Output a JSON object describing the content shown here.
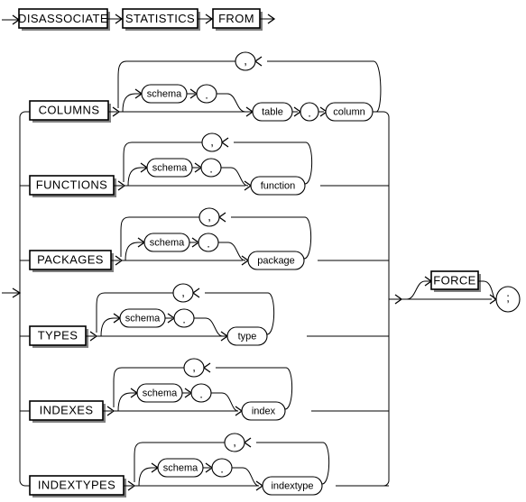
{
  "diagram": {
    "title": "disassociate_statistics_from",
    "type": "railroad-syntax-diagram",
    "colors": {
      "line": "#000000",
      "box_fill": "#ffffff",
      "box_shadow": "#808080",
      "background": "#ffffff"
    },
    "head": {
      "keywords": [
        {
          "id": "kw-disassociate",
          "label": "DISASSOCIATE"
        },
        {
          "id": "kw-statistics",
          "label": "STATISTICS"
        },
        {
          "id": "kw-from",
          "label": "FROM"
        }
      ]
    },
    "branches": [
      {
        "id": "columns",
        "keyword": "COLUMNS",
        "optional_schema": "schema",
        "dot": ".",
        "objects": [
          "table",
          "column"
        ],
        "object_separator": ".",
        "repeat_separator": ","
      },
      {
        "id": "functions",
        "keyword": "FUNCTIONS",
        "optional_schema": "schema",
        "dot": ".",
        "objects": [
          "function"
        ],
        "object_separator": "",
        "repeat_separator": ","
      },
      {
        "id": "packages",
        "keyword": "PACKAGES",
        "optional_schema": "schema",
        "dot": ".",
        "objects": [
          "package"
        ],
        "object_separator": "",
        "repeat_separator": ","
      },
      {
        "id": "types",
        "keyword": "TYPES",
        "optional_schema": "schema",
        "dot": ".",
        "objects": [
          "type"
        ],
        "object_separator": "",
        "repeat_separator": ","
      },
      {
        "id": "indexes",
        "keyword": "INDEXES",
        "optional_schema": "schema",
        "dot": ".",
        "objects": [
          "index"
        ],
        "object_separator": "",
        "repeat_separator": ","
      },
      {
        "id": "indextypes",
        "keyword": "INDEXTYPES",
        "optional_schema": "schema",
        "dot": ".",
        "objects": [
          "indextype"
        ],
        "object_separator": "",
        "repeat_separator": ","
      }
    ],
    "tail": {
      "optional_keyword": "FORCE",
      "terminator": ";"
    }
  }
}
